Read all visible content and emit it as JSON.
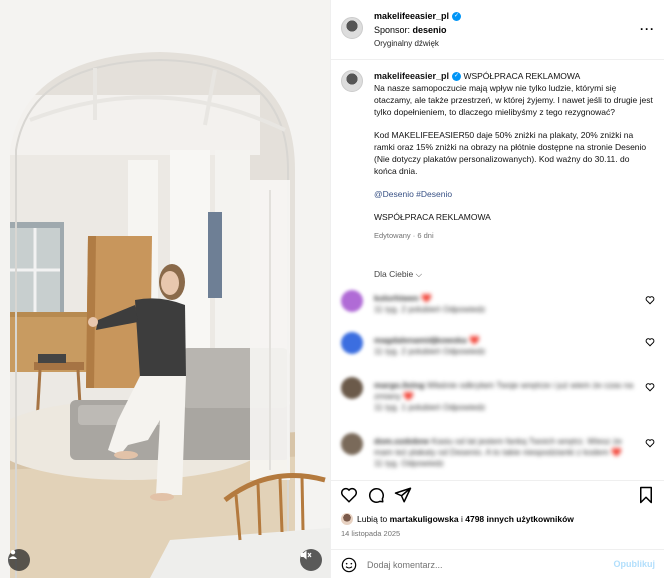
{
  "header": {
    "username": "makelifeeasier_pl",
    "verified": true,
    "sponsor_prefix": "Sponsor:",
    "sponsor_name": "desenio",
    "audio": "Oryginalny dźwięk",
    "more_icon": "more-horizontal-icon"
  },
  "caption": {
    "username": "makelifeeasier_pl",
    "label": "WSPÓŁPRACA REKLAMOWA",
    "para1": "Na nasze samopoczucie mają wpływ nie tylko ludzie, którymi się otaczamy, ale także przestrzeń, w której żyjemy. I nawet jeśli to drugie jest tylko dopełnieniem, to dlaczego mielibyśmy z tego rezygnować?",
    "para2": "Kod MAKELIFEEASIER50 daje 50% zniżki na plakaty, 20% zniżki na ramki oraz 15% zniżki na obrazy na płótnie dostępne na stronie Desenio (Nie dotyczy plakatów personalizowanych). Kod ważny do 30.11. do końca dnia.",
    "tags": "@Desenio #Desenio",
    "para3": "WSPÓŁPRACA REKLAMOWA",
    "edited": "Edytowany · 6 dni"
  },
  "sort_label": "Dla Ciebie",
  "comments": [
    {
      "user": "kolorhiwen",
      "text": "❤️",
      "meta": "11 tyg.   2 polubień   Odpowiedz",
      "avatar_color": "#b06bd6"
    },
    {
      "user": "magdalenamidjkowska",
      "text": "❤️",
      "meta": "11 tyg.   2 polubień   Odpowiedz",
      "avatar_color": "#3b6ee0"
    },
    {
      "user": "margo.living",
      "text": "Właśnie odkryłam Twoje wnętrze i już wiem że czas na zmiany ❤️",
      "meta": "11 tyg.   1 polubień   Odpowiedz",
      "avatar_color": "#6b5a4a"
    },
    {
      "user": "dom.ozdobne",
      "text": "Kasiu od lat jestem fanką Twoich wnętrz. Wiesz że mam też plakaty od Desenio. A to takie niespodzianki z kodem ❤️",
      "meta": "11 tyg.   Odpowiedz",
      "avatar_color": "#7a6a5a"
    }
  ],
  "actions": {
    "like_icon": "heart-icon",
    "comment_icon": "comment-icon",
    "share_icon": "send-icon",
    "save_icon": "bookmark-icon"
  },
  "likes": {
    "prefix": "Lubią to",
    "user": "martakuligowska",
    "middle": "i",
    "others": "4798 innych użytkowników"
  },
  "date": "14 listopada 2025",
  "add_comment": {
    "placeholder": "Dodaj komentarz...",
    "publish_label": "Opublikuj"
  }
}
